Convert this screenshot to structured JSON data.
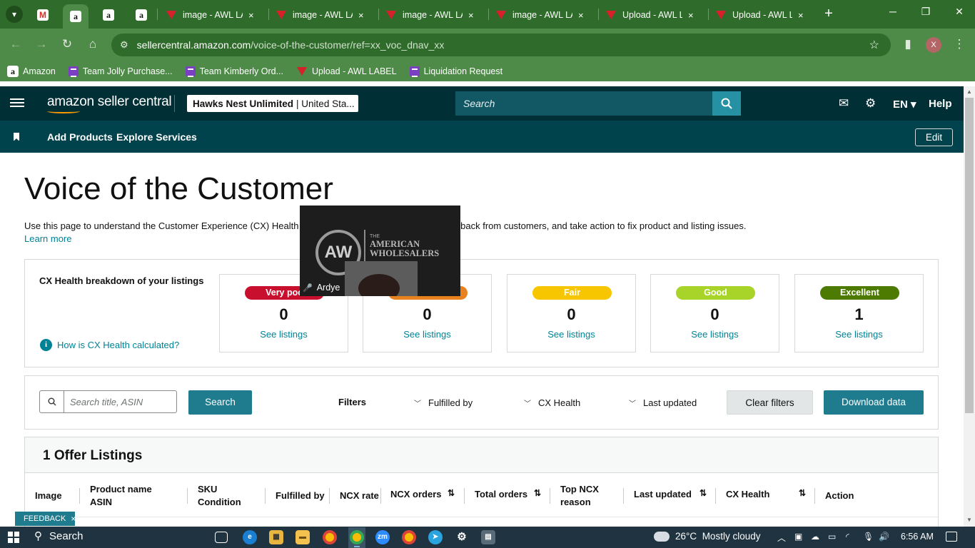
{
  "browser": {
    "tabs": [
      {
        "title": "image - AWL LA",
        "close": "×"
      },
      {
        "title": "image - AWL LA",
        "close": "×"
      },
      {
        "title": "image - AWL LA",
        "close": "×"
      },
      {
        "title": "image - AWL LA",
        "close": "×"
      },
      {
        "title": "Upload - AWL L",
        "close": "×"
      },
      {
        "title": "Upload - AWL L",
        "close": "×"
      }
    ],
    "pinned_icons": [
      "gmail-icon",
      "amazon-icon",
      "amazon-icon",
      "amazon-icon"
    ],
    "url_host": "sellercentral.amazon.com",
    "url_path": "/voice-of-the-customer/ref=xx_voc_dnav_xx",
    "profile_initial": "X",
    "bookmarks": [
      {
        "label": "Amazon",
        "icon": "amazon-icon"
      },
      {
        "label": "Team Jolly Purchase...",
        "icon": "list-icon"
      },
      {
        "label": "Team Kimberly Ord...",
        "icon": "list-icon"
      },
      {
        "label": "Upload - AWL LABEL",
        "icon": "awl-icon"
      },
      {
        "label": "Liquidation Request",
        "icon": "list-icon"
      }
    ]
  },
  "header": {
    "logo_text": "amazon seller central",
    "store_name": "Hawks Nest Unlimited",
    "store_region": "| United Sta...",
    "search_placeholder": "Search",
    "language": "EN",
    "help": "Help",
    "sub_links": [
      "Add Products",
      "Explore Services"
    ],
    "edit_label": "Edit"
  },
  "page": {
    "title": "Voice of the Customer",
    "intro_left": "Use this page to understand the Customer Experience (CX) Health",
    "intro_right": "g feedback from customers, and take action to fix product and listing issues.",
    "learn_more": "Learn more"
  },
  "cx_health": {
    "title": "CX Health breakdown of your listings",
    "help_link": "How is CX Health calculated?",
    "cards": [
      {
        "label": "Very poo",
        "count": "0",
        "link": "See listings",
        "color": "#c8102e",
        "text_color": "#ffffff"
      },
      {
        "label": "",
        "count": "0",
        "link": "See listings",
        "color": "#e8821e",
        "text_color": "#ffffff"
      },
      {
        "label": "Fair",
        "count": "0",
        "link": "See listings",
        "color": "#f7c600",
        "text_color": "#ffffff"
      },
      {
        "label": "Good",
        "count": "0",
        "link": "See listings",
        "color": "#a8d42a",
        "text_color": "#ffffff"
      },
      {
        "label": "Excellent",
        "count": "1",
        "link": "See listings",
        "color": "#4d7a00",
        "text_color": "#ffffff"
      }
    ]
  },
  "video_overlay": {
    "brand_the": "THE",
    "brand_line1": "AMERICAN",
    "brand_line2": "WHOLESALERS",
    "participant": "Ardye"
  },
  "filters": {
    "search_placeholder": "Search title, ASIN",
    "search_button": "Search",
    "filters_label": "Filters",
    "dropdowns": [
      "Fulfilled by",
      "CX Health",
      "Last updated"
    ],
    "clear_button": "Clear filters",
    "download_button": "Download data"
  },
  "table": {
    "title": "1 Offer Listings",
    "columns": [
      {
        "line1": "Image",
        "line2": ""
      },
      {
        "line1": "Product name",
        "line2": "ASIN"
      },
      {
        "line1": "SKU",
        "line2": "Condition"
      },
      {
        "line1": "Fulfilled by",
        "line2": ""
      },
      {
        "line1": "NCX rate",
        "line2": ""
      },
      {
        "line1": "NCX orders",
        "line2": ""
      },
      {
        "line1": "Total orders",
        "line2": ""
      },
      {
        "line1": "Top NCX",
        "line2": "reason"
      },
      {
        "line1": "Last updated",
        "line2": ""
      },
      {
        "line1": "CX Health",
        "line2": ""
      },
      {
        "line1": "Action",
        "line2": ""
      }
    ]
  },
  "feedback": {
    "label": "FEEDBACK",
    "close": "×"
  },
  "taskbar": {
    "search": "Search",
    "weather_temp": "26°C",
    "weather_desc": "Mostly cloudy",
    "time": "6:56 AM"
  }
}
